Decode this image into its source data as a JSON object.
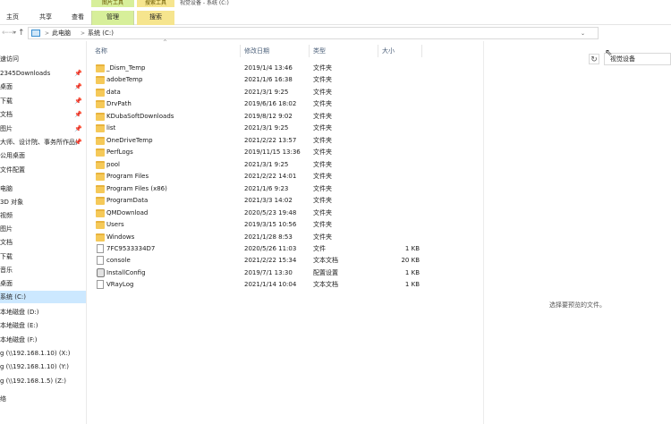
{
  "ribbon": {
    "context_tab_1": "图片工具",
    "context_tab_2": "搜索工具",
    "window_title": "视觉设备 - 系统 (C:)",
    "tabs": [
      "主页",
      "共享",
      "查看",
      "管理",
      "搜索"
    ]
  },
  "address": {
    "crumbs": [
      "此电脑",
      "系统 (C:)"
    ],
    "separator": ">",
    "search_value": "视觉设备"
  },
  "sidebar": {
    "items": [
      {
        "label": "速访问",
        "pinned": false
      },
      {
        "label": "2345Downloads",
        "pinned": true
      },
      {
        "label": "桌面",
        "pinned": true
      },
      {
        "label": "下载",
        "pinned": true
      },
      {
        "label": "文档",
        "pinned": true
      },
      {
        "label": "图片",
        "pinned": true
      },
      {
        "label": "大师、设计院、事务所作品(",
        "pinned": true
      },
      {
        "label": "公用桌面",
        "pinned": false
      },
      {
        "label": "文件配置",
        "pinned": false
      },
      {
        "label": "电脑",
        "pinned": false
      },
      {
        "label": "3D 对象",
        "pinned": false
      },
      {
        "label": "视频",
        "pinned": false
      },
      {
        "label": "图片",
        "pinned": false
      },
      {
        "label": "文档",
        "pinned": false
      },
      {
        "label": "下载",
        "pinned": false
      },
      {
        "label": "音乐",
        "pinned": false
      },
      {
        "label": "桌面",
        "pinned": false
      },
      {
        "label": "系统 (C:)",
        "pinned": false
      },
      {
        "label": "本地磁盘 (D:)",
        "pinned": false
      },
      {
        "label": "本地磁盘 (E:)",
        "pinned": false
      },
      {
        "label": "本地磁盘 (F:)",
        "pinned": false
      },
      {
        "label": "g (\\\\192.168.1.10) (X:)",
        "pinned": false
      },
      {
        "label": "g (\\\\192.168.1.10) (Y:)",
        "pinned": false
      },
      {
        "label": "g (\\\\192.168.1.5) (Z:)",
        "pinned": false
      },
      {
        "label": "络",
        "pinned": false
      }
    ],
    "pin_glyph": "📌"
  },
  "columns": {
    "name": "名称",
    "date": "修改日期",
    "type": "类型",
    "size": "大小"
  },
  "files": [
    {
      "name": "_Dism_Temp",
      "date": "2019/1/4 13:46",
      "type": "文件夹",
      "size": "",
      "icon": "folder-icon"
    },
    {
      "name": "adobeTemp",
      "date": "2021/1/6 16:38",
      "type": "文件夹",
      "size": "",
      "icon": "folder-icon"
    },
    {
      "name": "data",
      "date": "2021/3/1 9:25",
      "type": "文件夹",
      "size": "",
      "icon": "folder-icon"
    },
    {
      "name": "DrvPath",
      "date": "2019/6/16 18:02",
      "type": "文件夹",
      "size": "",
      "icon": "folder-icon"
    },
    {
      "name": "KDubaSoftDownloads",
      "date": "2019/8/12 9:02",
      "type": "文件夹",
      "size": "",
      "icon": "folder-icon"
    },
    {
      "name": "list",
      "date": "2021/3/1 9:25",
      "type": "文件夹",
      "size": "",
      "icon": "folder-icon"
    },
    {
      "name": "OneDriveTemp",
      "date": "2021/2/22 13:57",
      "type": "文件夹",
      "size": "",
      "icon": "folder-icon"
    },
    {
      "name": "PerfLogs",
      "date": "2019/11/15 13:36",
      "type": "文件夹",
      "size": "",
      "icon": "folder-icon"
    },
    {
      "name": "pool",
      "date": "2021/3/1 9:25",
      "type": "文件夹",
      "size": "",
      "icon": "folder-icon"
    },
    {
      "name": "Program Files",
      "date": "2021/2/22 14:01",
      "type": "文件夹",
      "size": "",
      "icon": "folder-icon"
    },
    {
      "name": "Program Files (x86)",
      "date": "2021/1/6 9:23",
      "type": "文件夹",
      "size": "",
      "icon": "folder-icon"
    },
    {
      "name": "ProgramData",
      "date": "2021/3/3 14:02",
      "type": "文件夹",
      "size": "",
      "icon": "folder-icon"
    },
    {
      "name": "QMDownload",
      "date": "2020/5/23 19:48",
      "type": "文件夹",
      "size": "",
      "icon": "folder-icon"
    },
    {
      "name": "Users",
      "date": "2019/3/15 10:56",
      "type": "文件夹",
      "size": "",
      "icon": "folder-icon"
    },
    {
      "name": "Windows",
      "date": "2021/1/28 8:53",
      "type": "文件夹",
      "size": "",
      "icon": "folder-icon"
    },
    {
      "name": "7FC9533334D7",
      "date": "2020/5/26 11:03",
      "type": "文件",
      "size": "1 KB",
      "icon": "file-icon"
    },
    {
      "name": "console",
      "date": "2021/2/22 15:34",
      "type": "文本文档",
      "size": "20 KB",
      "icon": "text-file-icon"
    },
    {
      "name": "InstallConfig",
      "date": "2019/7/1 13:30",
      "type": "配置设置",
      "size": "1 KB",
      "icon": "config-file-icon"
    },
    {
      "name": "VRayLog",
      "date": "2021/1/14 10:04",
      "type": "文本文档",
      "size": "1 KB",
      "icon": "text-file-icon"
    }
  ],
  "preview": {
    "empty_message": "选择要预览的文件。"
  },
  "colors": {
    "selected_nav": "#cce8ff",
    "folder": "#f5c959",
    "context_green": "#d7ef9a",
    "context_yellow": "#f6e58e"
  }
}
